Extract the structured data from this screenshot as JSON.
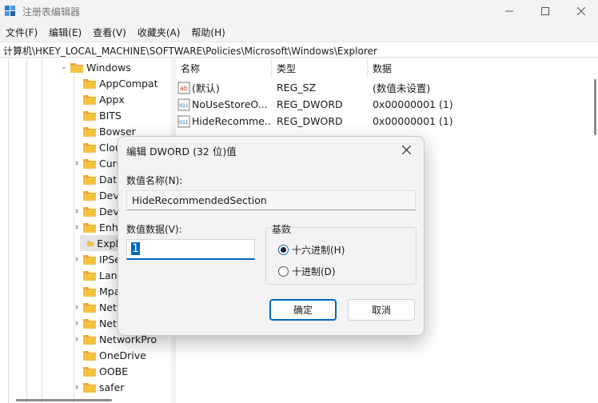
{
  "window": {
    "title": "注册表编辑器"
  },
  "menu": [
    "文件(F)",
    "编辑(E)",
    "查看(V)",
    "收藏夹(A)",
    "帮助(H)"
  ],
  "address": "计算机\\HKEY_LOCAL_MACHINE\\SOFTWARE\\Policies\\Microsoft\\Windows\\Explorer",
  "tree": {
    "items": [
      {
        "label": "Windows",
        "expanded": true
      },
      {
        "label": "AppCompat"
      },
      {
        "label": "Appx"
      },
      {
        "label": "BITS"
      },
      {
        "label": "Bowser"
      },
      {
        "label": "Clou"
      },
      {
        "label": "Curr"
      },
      {
        "label": "Data"
      },
      {
        "label": "Devi"
      },
      {
        "label": "Devi"
      },
      {
        "label": "Enha"
      },
      {
        "label": "Expl"
      },
      {
        "label": "IPSe"
      },
      {
        "label": "Lann"
      },
      {
        "label": "Mpa"
      },
      {
        "label": "Netw"
      },
      {
        "label": "Netw"
      },
      {
        "label": "NetworkPro"
      },
      {
        "label": "OneDrive"
      },
      {
        "label": "OOBE"
      },
      {
        "label": "safer"
      }
    ]
  },
  "list": {
    "headers": [
      "名称",
      "类型",
      "数据"
    ],
    "rows": [
      {
        "name": "(默认)",
        "type": "REG_SZ",
        "data": "(数值未设置)",
        "icon": "string-value-icon"
      },
      {
        "name": "NoUseStoreO...",
        "type": "REG_DWORD",
        "data": "0x00000001 (1)",
        "icon": "binary-value-icon"
      },
      {
        "name": "HideRecomme...",
        "type": "REG_DWORD",
        "data": "0x00000001 (1)",
        "icon": "binary-value-icon"
      }
    ]
  },
  "dialog": {
    "title": "编辑 DWORD (32 位)值",
    "name_label": "数值名称(N):",
    "name_value": "HideRecommendedSection",
    "data_label": "数值数据(V):",
    "data_value": "1",
    "base_label": "基数",
    "hex_label": "十六进制(H)",
    "dec_label": "十进制(D)",
    "ok_label": "确定",
    "cancel_label": "取消"
  },
  "colors": {
    "accent": "#0067c0",
    "folder": "#f4c243"
  }
}
